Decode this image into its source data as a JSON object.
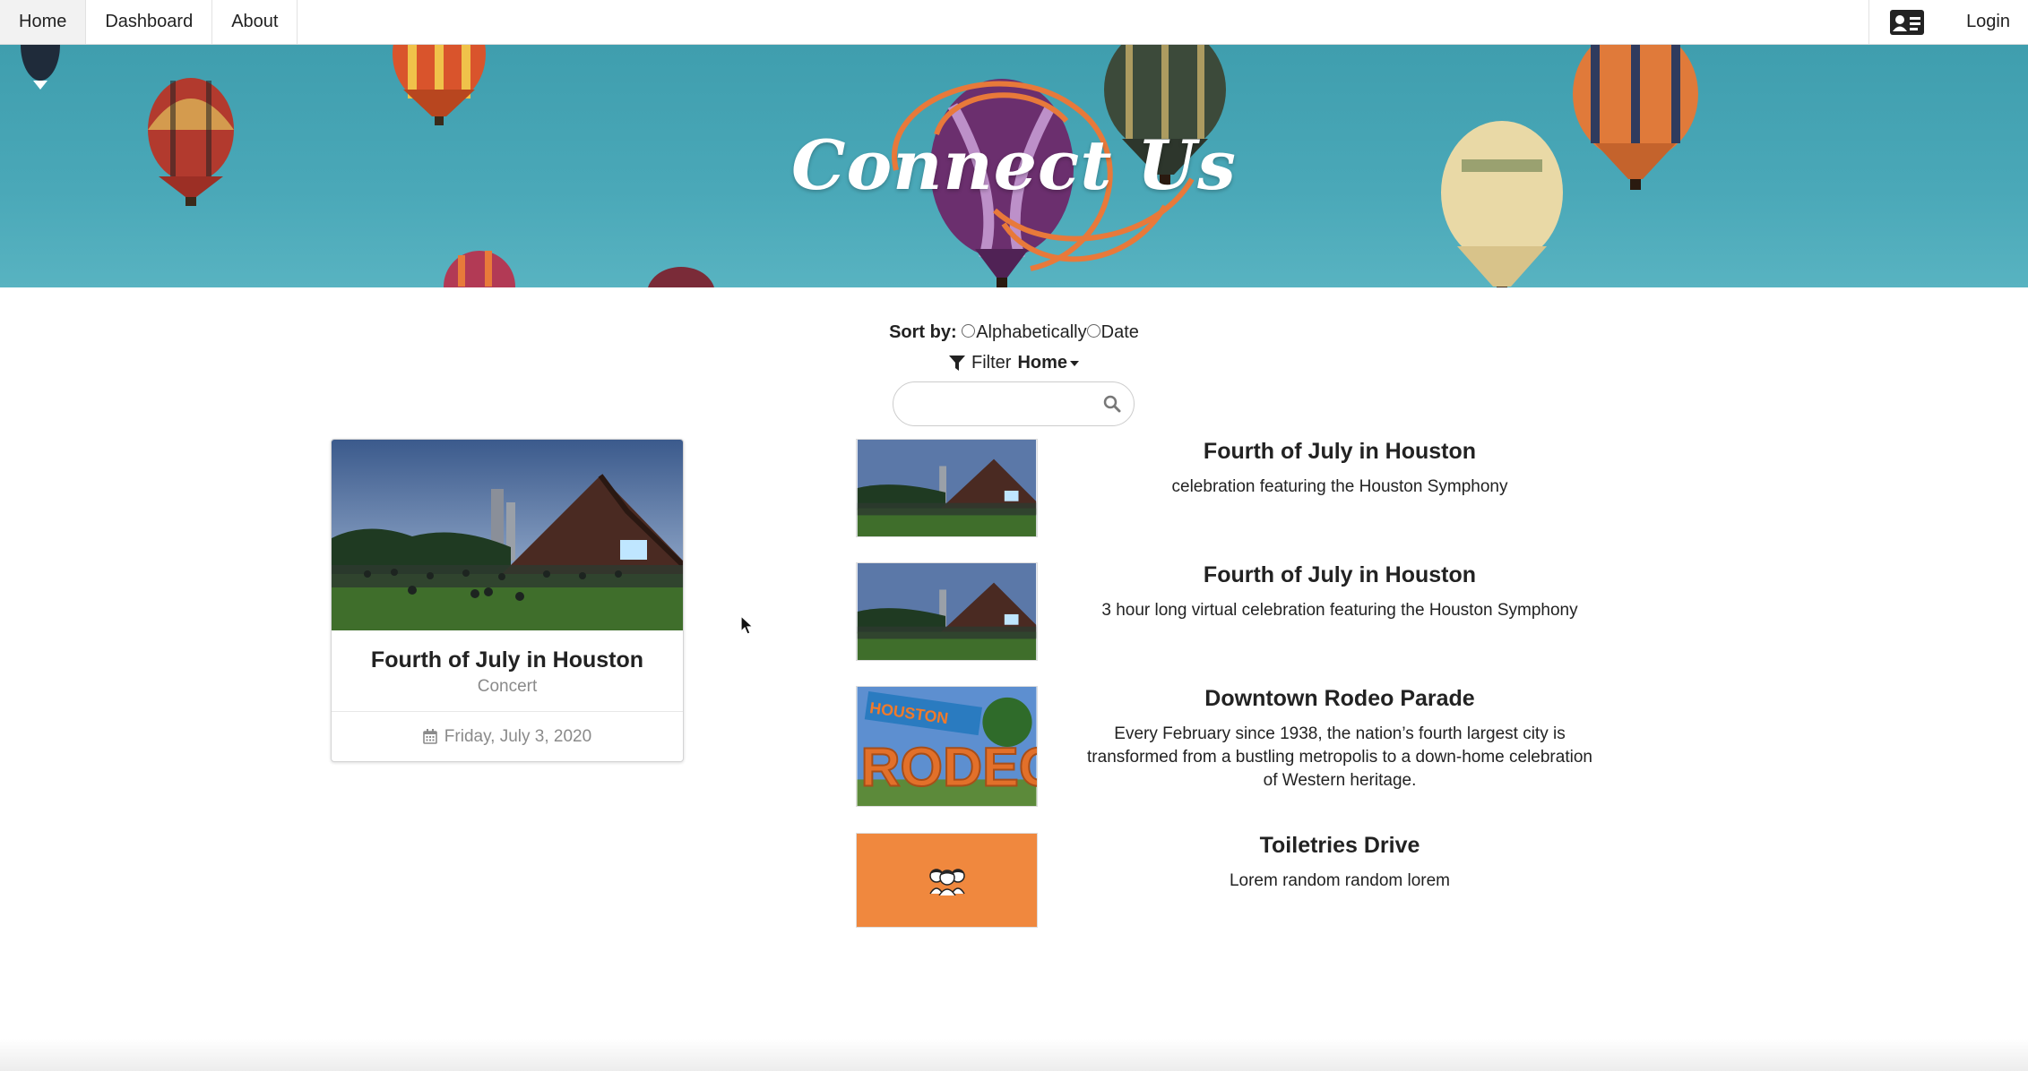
{
  "nav": {
    "items": [
      {
        "label": "Home",
        "active": true
      },
      {
        "label": "Dashboard",
        "active": false
      },
      {
        "label": "About",
        "active": false
      }
    ],
    "profile_icon": "id-card-icon",
    "login_label": "Login"
  },
  "hero": {
    "title": "Connect Us"
  },
  "controls": {
    "sort_label": "Sort by:",
    "sort_options": [
      "Alphabetically",
      "Date"
    ],
    "filter_label": "Filter",
    "filter_value": "Home",
    "search_placeholder": ""
  },
  "featured": {
    "title": "Fourth of July in Houston",
    "category": "Concert",
    "date": "Friday, July 3, 2020"
  },
  "events": [
    {
      "title": "Fourth of July in Houston",
      "description": "celebration featuring the Houston Symphony",
      "image": "concert-lawn-photo"
    },
    {
      "title": "Fourth of July in Houston",
      "description": "3 hour long virtual celebration featuring the Houston Symphony",
      "image": "concert-lawn-photo"
    },
    {
      "title": "Downtown Rodeo Parade",
      "description": "Every February since 1938, the nation’s fourth largest city is transformed from a bustling metropolis to a down-home celebration of Western heritage.",
      "image": "rodeo-sign-photo",
      "image_text": "RODEO",
      "image_subtext": "HOUSTON"
    },
    {
      "title": "Toiletries Drive",
      "description": "Lorem random random lorem",
      "image": "people-group-icon"
    }
  ],
  "colors": {
    "hero_bg": "#4aa8b8",
    "accent_orange": "#f0883e",
    "text": "#222222",
    "muted": "#8a8a8a"
  }
}
